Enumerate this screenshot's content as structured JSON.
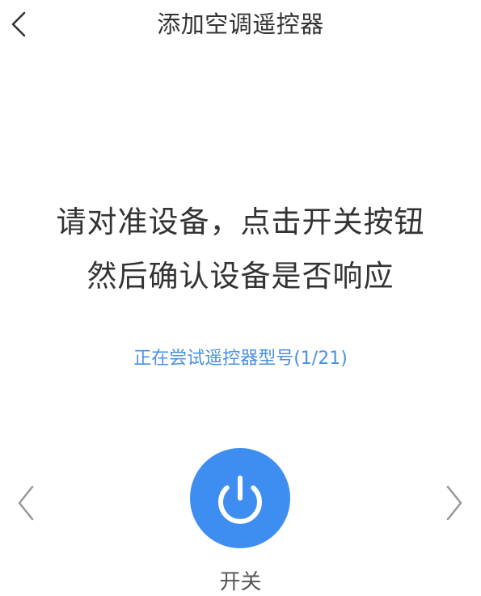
{
  "header": {
    "back_icon": "chevron-left-icon",
    "title": "添加空调遥控器"
  },
  "instructions": {
    "line1": "请对准设备，点击开关按钮",
    "line2": "然后确认设备是否响应"
  },
  "status": {
    "text": "正在尝试遥控器型号(1/21)",
    "color": "#4a90e2"
  },
  "controls": {
    "prev_icon": "chevron-left-icon",
    "next_icon": "chevron-right-icon",
    "power_icon": "power-icon",
    "power_color": "#3d8ef0",
    "power_label": "开关"
  }
}
